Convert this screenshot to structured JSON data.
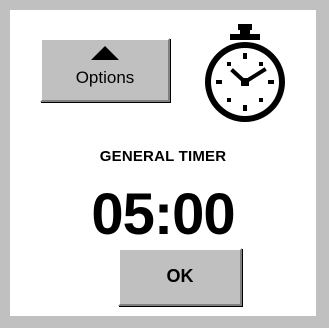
{
  "window": {
    "background_color": "#c0c0c0",
    "panel_color": "#ffffff"
  },
  "options_button": {
    "label": "Options",
    "icon": "arrow-up-icon"
  },
  "stopwatch": {
    "icon": "stopwatch-icon"
  },
  "timer": {
    "title": "GENERAL TIMER",
    "time": "05:00"
  },
  "ok_button": {
    "label": "OK"
  }
}
